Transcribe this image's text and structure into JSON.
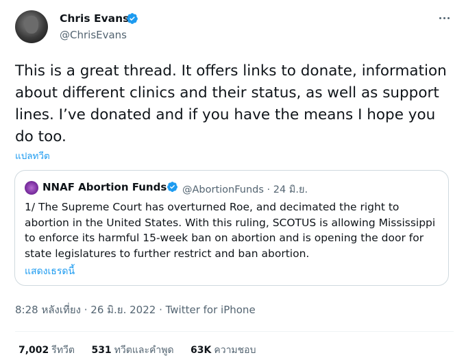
{
  "author": {
    "name": "Chris Evans",
    "handle": "@ChrisEvans"
  },
  "tweet": {
    "text": "This is a great thread. It offers links to donate, information about different clinics and their status, as well as support lines. I’ve donated and if you have the means I hope you do too.",
    "translate_label": "แปลทวีต"
  },
  "quoted": {
    "name": "NNAF Abortion Funds",
    "handle_date": "@AbortionFunds · 24 มิ.ย.",
    "text": "1/ The Supreme Court has overturned Roe, and decimated the right to abortion in the United States. With this ruling, SCOTUS is allowing Mississippi to enforce its harmful 15-week ban on abortion and is opening the door for state legislatures to further restrict and ban abortion.",
    "show_thread": "แสดงเธรดนี้"
  },
  "meta": "8:28 หลังเที่ยง · 26 มิ.ย. 2022 · Twitter for iPhone",
  "stats": [
    {
      "count": "7,002",
      "label": "รีทวีต"
    },
    {
      "count": "531",
      "label": "ทวีตและคำพูด"
    },
    {
      "count": "63K",
      "label": "ความชอบ"
    }
  ],
  "colors": {
    "accent": "#1d9bf0",
    "secondary_text": "#536471",
    "border": "#cfd9de"
  },
  "icons": [
    "verified-badge-icon",
    "more-options-icon"
  ]
}
